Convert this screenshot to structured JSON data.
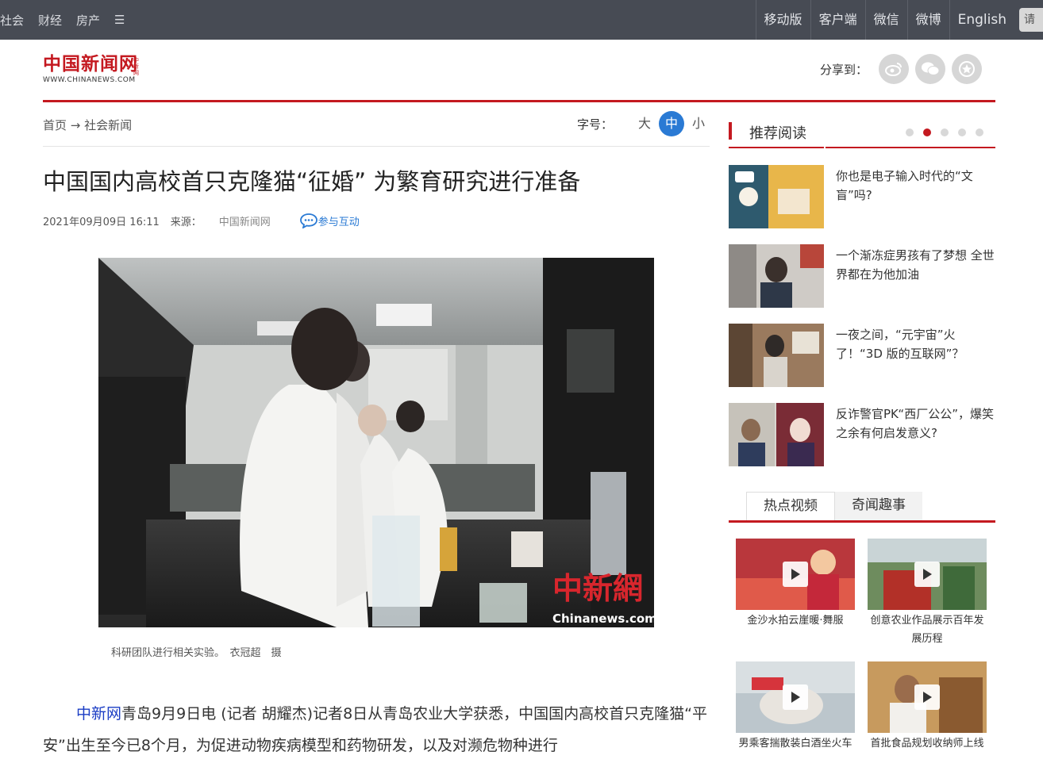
{
  "topbar": {
    "left_nav": [
      "社会",
      "财经",
      "房产",
      "☰"
    ],
    "right_nav": [
      "移动版",
      "客户端",
      "微信",
      "微博",
      "English"
    ],
    "search_stub": "请"
  },
  "logo": {
    "cn": "中国新闻网",
    "en": "WWW.CHINANEWS.COM",
    "side": "中新网"
  },
  "share": {
    "label": "分享到：",
    "icons": [
      "weibo-icon",
      "wechat-icon",
      "favorite-icon"
    ]
  },
  "breadcrumb": {
    "home": "首页",
    "arrow": "→",
    "section": "社会新闻"
  },
  "font_size": {
    "label": "字号：",
    "options": [
      "大",
      "中",
      "小"
    ],
    "selected": "中"
  },
  "article": {
    "title": "中国国内高校首只克隆猫“征婚” 为繁育研究进行准备",
    "datetime": "2021年09月09日 16:11",
    "source_label": "来源：",
    "source": "中国新闻网",
    "interact": "参与互动",
    "photo_watermark_cn": "中新網",
    "photo_watermark_en": "Chinanews.com",
    "photo_caption": "科研团队进行相关实验。　衣冠超　摄",
    "para_name": "中新网",
    "para_text": "青岛9月9日电 (记者 胡耀杰)记者8日从青岛农业大学获悉，中国国内高校首只克隆猫“平安”出生至今已8个月，为促进动物疾病模型和药物研发，以及对濒危物种进行"
  },
  "sidebar": {
    "heading": "推荐阅读",
    "recommended": [
      {
        "title": "你也是电子输入时代的“文盲”吗?"
      },
      {
        "title": "一个渐冻症男孩有了梦想 全世界都在为他加油"
      },
      {
        "title": "一夜之间，“元宇宙”火了！“3D 版的互联网”？"
      },
      {
        "title": "反诈警官PK“西厂公公”，爆笑之余有何启发意义?"
      }
    ],
    "tabs": [
      "热点视频",
      "奇闻趣事"
    ],
    "videos": [
      {
        "caption": "金沙水拍云崖暖·舞服"
      },
      {
        "caption": "创意农业作品展示百年发展历程"
      },
      {
        "caption": "男乘客揣散装白酒坐火车"
      },
      {
        "caption": "首批食品规划收纳师上线"
      }
    ]
  }
}
